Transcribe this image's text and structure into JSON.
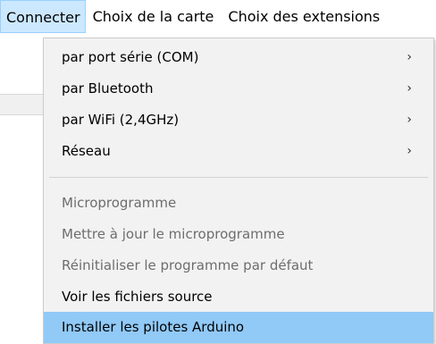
{
  "menubar": {
    "items": [
      {
        "label": "Connecter"
      },
      {
        "label": "Choix de la carte"
      },
      {
        "label": "Choix des extensions"
      }
    ]
  },
  "dropdown": {
    "items": [
      {
        "label": "par port série (COM)",
        "submenu": true
      },
      {
        "label": "par Bluetooth",
        "submenu": true
      },
      {
        "label": "par WiFi (2,4GHz)",
        "submenu": true
      },
      {
        "label": "Réseau",
        "submenu": true
      },
      {
        "label": "Microprogramme",
        "disabled": true
      },
      {
        "label": "Mettre à jour le microprogramme",
        "disabled": true
      },
      {
        "label": "Réinitialiser le programme par défaut",
        "disabled": true
      },
      {
        "label": "Voir les fichiers source"
      },
      {
        "label": "Installer les pilotes Arduino",
        "highlighted": true
      }
    ],
    "submenu_arrow": "›"
  },
  "colors": {
    "menubar_active": "#cce8ff",
    "item_highlight": "#91c9f7",
    "dropdown_bg": "#f2f2f2",
    "disabled_text": "#6d6d6d"
  }
}
